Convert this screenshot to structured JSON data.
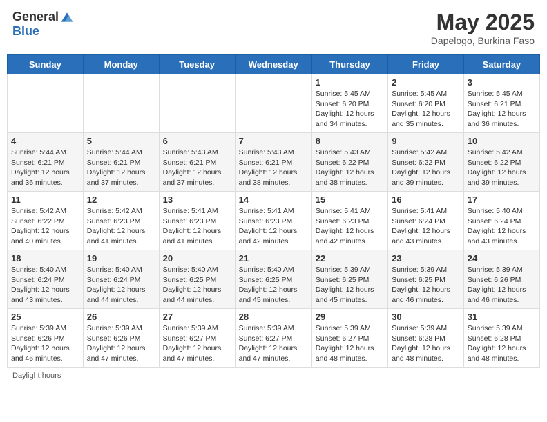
{
  "header": {
    "logo_general": "General",
    "logo_blue": "Blue",
    "title": "May 2025",
    "subtitle": "Dapelogo, Burkina Faso"
  },
  "days_of_week": [
    "Sunday",
    "Monday",
    "Tuesday",
    "Wednesday",
    "Thursday",
    "Friday",
    "Saturday"
  ],
  "weeks": [
    [
      {
        "day": "",
        "info": ""
      },
      {
        "day": "",
        "info": ""
      },
      {
        "day": "",
        "info": ""
      },
      {
        "day": "",
        "info": ""
      },
      {
        "day": "1",
        "info": "Sunrise: 5:45 AM\nSunset: 6:20 PM\nDaylight: 12 hours\nand 34 minutes."
      },
      {
        "day": "2",
        "info": "Sunrise: 5:45 AM\nSunset: 6:20 PM\nDaylight: 12 hours\nand 35 minutes."
      },
      {
        "day": "3",
        "info": "Sunrise: 5:45 AM\nSunset: 6:21 PM\nDaylight: 12 hours\nand 36 minutes."
      }
    ],
    [
      {
        "day": "4",
        "info": "Sunrise: 5:44 AM\nSunset: 6:21 PM\nDaylight: 12 hours\nand 36 minutes."
      },
      {
        "day": "5",
        "info": "Sunrise: 5:44 AM\nSunset: 6:21 PM\nDaylight: 12 hours\nand 37 minutes."
      },
      {
        "day": "6",
        "info": "Sunrise: 5:43 AM\nSunset: 6:21 PM\nDaylight: 12 hours\nand 37 minutes."
      },
      {
        "day": "7",
        "info": "Sunrise: 5:43 AM\nSunset: 6:21 PM\nDaylight: 12 hours\nand 38 minutes."
      },
      {
        "day": "8",
        "info": "Sunrise: 5:43 AM\nSunset: 6:22 PM\nDaylight: 12 hours\nand 38 minutes."
      },
      {
        "day": "9",
        "info": "Sunrise: 5:42 AM\nSunset: 6:22 PM\nDaylight: 12 hours\nand 39 minutes."
      },
      {
        "day": "10",
        "info": "Sunrise: 5:42 AM\nSunset: 6:22 PM\nDaylight: 12 hours\nand 39 minutes."
      }
    ],
    [
      {
        "day": "11",
        "info": "Sunrise: 5:42 AM\nSunset: 6:22 PM\nDaylight: 12 hours\nand 40 minutes."
      },
      {
        "day": "12",
        "info": "Sunrise: 5:42 AM\nSunset: 6:23 PM\nDaylight: 12 hours\nand 41 minutes."
      },
      {
        "day": "13",
        "info": "Sunrise: 5:41 AM\nSunset: 6:23 PM\nDaylight: 12 hours\nand 41 minutes."
      },
      {
        "day": "14",
        "info": "Sunrise: 5:41 AM\nSunset: 6:23 PM\nDaylight: 12 hours\nand 42 minutes."
      },
      {
        "day": "15",
        "info": "Sunrise: 5:41 AM\nSunset: 6:23 PM\nDaylight: 12 hours\nand 42 minutes."
      },
      {
        "day": "16",
        "info": "Sunrise: 5:41 AM\nSunset: 6:24 PM\nDaylight: 12 hours\nand 43 minutes."
      },
      {
        "day": "17",
        "info": "Sunrise: 5:40 AM\nSunset: 6:24 PM\nDaylight: 12 hours\nand 43 minutes."
      }
    ],
    [
      {
        "day": "18",
        "info": "Sunrise: 5:40 AM\nSunset: 6:24 PM\nDaylight: 12 hours\nand 43 minutes."
      },
      {
        "day": "19",
        "info": "Sunrise: 5:40 AM\nSunset: 6:24 PM\nDaylight: 12 hours\nand 44 minutes."
      },
      {
        "day": "20",
        "info": "Sunrise: 5:40 AM\nSunset: 6:25 PM\nDaylight: 12 hours\nand 44 minutes."
      },
      {
        "day": "21",
        "info": "Sunrise: 5:40 AM\nSunset: 6:25 PM\nDaylight: 12 hours\nand 45 minutes."
      },
      {
        "day": "22",
        "info": "Sunrise: 5:39 AM\nSunset: 6:25 PM\nDaylight: 12 hours\nand 45 minutes."
      },
      {
        "day": "23",
        "info": "Sunrise: 5:39 AM\nSunset: 6:25 PM\nDaylight: 12 hours\nand 46 minutes."
      },
      {
        "day": "24",
        "info": "Sunrise: 5:39 AM\nSunset: 6:26 PM\nDaylight: 12 hours\nand 46 minutes."
      }
    ],
    [
      {
        "day": "25",
        "info": "Sunrise: 5:39 AM\nSunset: 6:26 PM\nDaylight: 12 hours\nand 46 minutes."
      },
      {
        "day": "26",
        "info": "Sunrise: 5:39 AM\nSunset: 6:26 PM\nDaylight: 12 hours\nand 47 minutes."
      },
      {
        "day": "27",
        "info": "Sunrise: 5:39 AM\nSunset: 6:27 PM\nDaylight: 12 hours\nand 47 minutes."
      },
      {
        "day": "28",
        "info": "Sunrise: 5:39 AM\nSunset: 6:27 PM\nDaylight: 12 hours\nand 47 minutes."
      },
      {
        "day": "29",
        "info": "Sunrise: 5:39 AM\nSunset: 6:27 PM\nDaylight: 12 hours\nand 48 minutes."
      },
      {
        "day": "30",
        "info": "Sunrise: 5:39 AM\nSunset: 6:28 PM\nDaylight: 12 hours\nand 48 minutes."
      },
      {
        "day": "31",
        "info": "Sunrise: 5:39 AM\nSunset: 6:28 PM\nDaylight: 12 hours\nand 48 minutes."
      }
    ]
  ],
  "footer": "Daylight hours"
}
